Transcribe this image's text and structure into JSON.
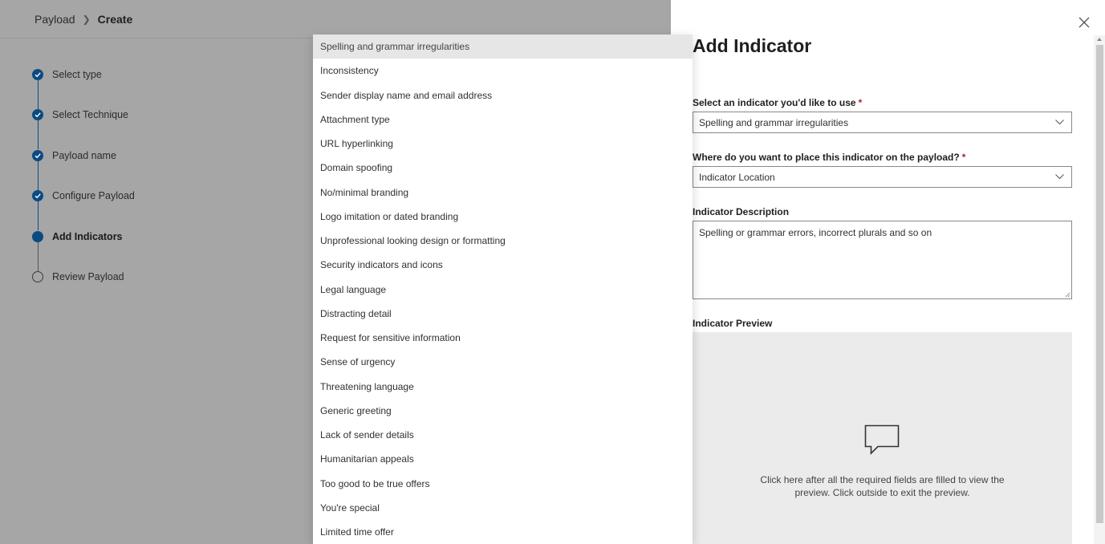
{
  "breadcrumb": {
    "root": "Payload",
    "current": "Create"
  },
  "steps": [
    {
      "label": "Select type",
      "state": "done"
    },
    {
      "label": "Select Technique",
      "state": "done"
    },
    {
      "label": "Payload name",
      "state": "done"
    },
    {
      "label": "Configure Payload",
      "state": "done"
    },
    {
      "label": "Add Indicators",
      "state": "current"
    },
    {
      "label": "Review Payload",
      "state": "pending"
    }
  ],
  "dropdown": {
    "options": [
      "Spelling and grammar irregularities",
      "Inconsistency",
      "Sender display name and email address",
      "Attachment type",
      "URL hyperlinking",
      "Domain spoofing",
      "No/minimal branding",
      "Logo imitation or dated branding",
      "Unprofessional looking design or formatting",
      "Security indicators and icons",
      "Legal language",
      "Distracting detail",
      "Request for sensitive information",
      "Sense of urgency",
      "Threatening language",
      "Generic greeting",
      "Lack of sender details",
      "Humanitarian appeals",
      "Too good to be true offers",
      "You're special",
      "Limited time offer"
    ],
    "selected_index": 0
  },
  "panel": {
    "title": "Add Indicator",
    "indicator_label": "Select an indicator you'd like to use",
    "indicator_value": "Spelling and grammar irregularities",
    "location_label": "Where do you want to place this indicator on the payload?",
    "location_value": "Indicator Location",
    "description_label": "Indicator Description",
    "description_value": "Spelling or grammar errors, incorrect plurals and so on",
    "preview_label": "Indicator Preview",
    "preview_hint": "Click here after all the required fields are filled to view the preview. Click outside to exit the preview.",
    "required_mark": "*"
  },
  "colors": {
    "accent": "#0b4a82",
    "overlay": "#a6a6a6",
    "required": "#a4262c",
    "preview_bg": "#ebebeb"
  },
  "icons": {
    "close": "close-icon",
    "chevron": "chevron-down-icon",
    "check": "checkmark-icon",
    "preview": "comment-bubble-icon"
  }
}
